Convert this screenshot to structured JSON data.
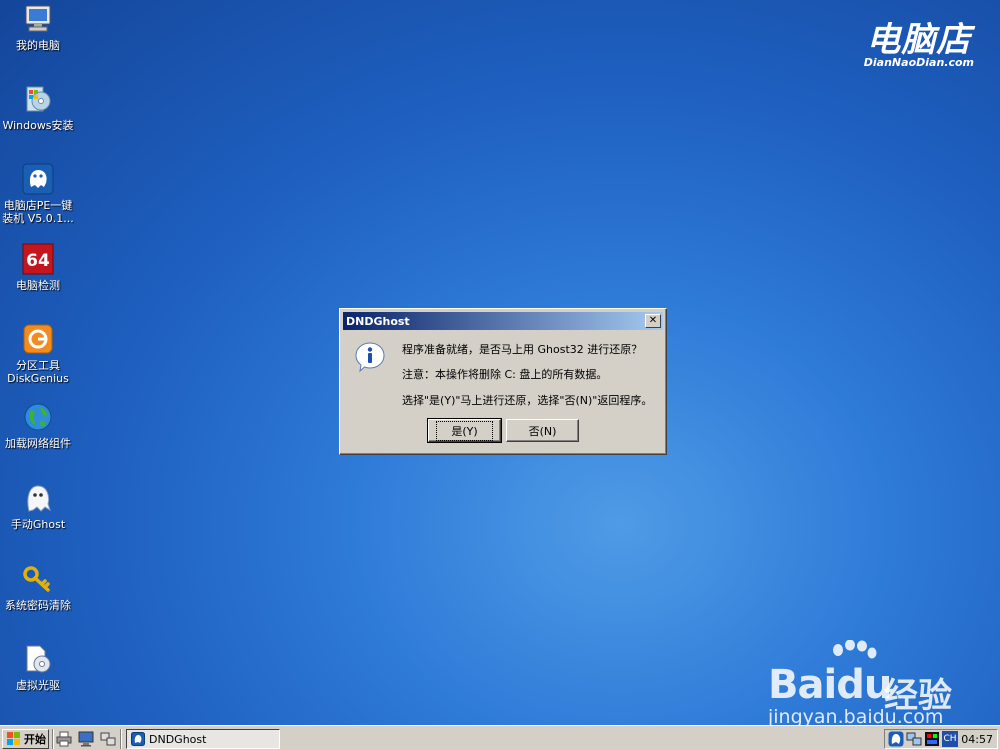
{
  "desktop": {
    "icons": [
      {
        "label": "我的电脑",
        "icon": "my-computer-icon"
      },
      {
        "label": "Windows安装",
        "icon": "windows-install-icon"
      },
      {
        "label": "电脑店PE一键\n装机 V5.0.1...",
        "icon": "pe-installer-icon"
      },
      {
        "label": "电脑检测",
        "icon": "aida64-icon"
      },
      {
        "label": "分区工具\nDiskGenius",
        "icon": "diskgenius-icon"
      },
      {
        "label": "加载网络组件",
        "icon": "network-globe-icon"
      },
      {
        "label": "手动Ghost",
        "icon": "ghost-icon"
      },
      {
        "label": "系统密码清除",
        "icon": "key-icon"
      },
      {
        "label": "虚拟光驱",
        "icon": "virtual-drive-icon"
      }
    ]
  },
  "brand": {
    "main": "电脑店",
    "sub": "DianNaoDian.com"
  },
  "watermark": {
    "word": "Bai",
    "word2": "du",
    "jingyan": "经验",
    "url": "jingyan.baidu.com"
  },
  "dialog": {
    "title": "DNDGhost",
    "close": "✕",
    "icon": "info-icon",
    "line1": "程序准备就绪，是否马上用 Ghost32 进行还原？",
    "line2": "注意：本操作将删除 C: 盘上的所有数据。",
    "line3": "选择\"是(Y)\"马上进行还原，选择\"否(N)\"返回程序。",
    "yes_label": "是(Y)",
    "no_label": "否(N)"
  },
  "taskbar": {
    "start_label": "开始",
    "task_label": "DNDGhost",
    "quick_icons": [
      "printer-icon",
      "monitor-icon",
      "network-icon"
    ],
    "tray_icons": [
      "pe-tray-icon",
      "network-tray-icon",
      "display-tray-icon"
    ],
    "ime": "CH",
    "clock": "04:57"
  },
  "colors": {
    "desktop": "#2f7bd8",
    "titlebar_start": "#0a246a",
    "titlebar_end": "#a6caf0",
    "window_face": "#d4d0c8"
  }
}
